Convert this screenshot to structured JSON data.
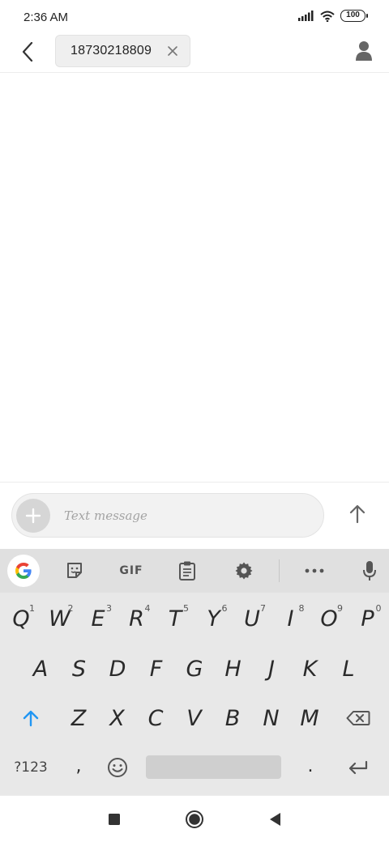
{
  "status_bar": {
    "time": "2:36 AM",
    "battery": "100",
    "icons": [
      "signal-icon",
      "wifi-icon",
      "battery-icon"
    ]
  },
  "header": {
    "back_icon": "chevron-left-icon",
    "recipient": "18730218809",
    "chip_close_icon": "close-icon",
    "contact_icon": "person-icon"
  },
  "compose": {
    "attach_icon": "plus-icon",
    "placeholder": "Text message",
    "send_icon": "arrow-up-icon"
  },
  "keyboard": {
    "toolbar": {
      "items": [
        "google-icon",
        "sticker-icon",
        "gif",
        "clipboard-icon",
        "gear-icon",
        "more-icon",
        "microphone-icon"
      ],
      "gif_label": "GIF"
    },
    "row1": [
      {
        "key": "Q",
        "hint": "1"
      },
      {
        "key": "W",
        "hint": "2"
      },
      {
        "key": "E",
        "hint": "3"
      },
      {
        "key": "R",
        "hint": "4"
      },
      {
        "key": "T",
        "hint": "5"
      },
      {
        "key": "Y",
        "hint": "6"
      },
      {
        "key": "U",
        "hint": "7"
      },
      {
        "key": "I",
        "hint": "8"
      },
      {
        "key": "O",
        "hint": "9"
      },
      {
        "key": "P",
        "hint": "0"
      }
    ],
    "row2": [
      "A",
      "S",
      "D",
      "F",
      "G",
      "H",
      "J",
      "K",
      "L"
    ],
    "row3": [
      "Z",
      "X",
      "C",
      "V",
      "B",
      "N",
      "M"
    ],
    "row4": {
      "symbols": "?123",
      "comma": ",",
      "period": ".",
      "emoji_icon": "emoji-icon",
      "enter_icon": "enter-icon"
    },
    "shift_icon": "shift-arrow-icon",
    "backspace_icon": "backspace-icon",
    "accent_color": "#2196f3"
  },
  "nav_bar": {
    "items": [
      "recents-square-icon",
      "home-circle-icon",
      "back-triangle-icon"
    ]
  }
}
